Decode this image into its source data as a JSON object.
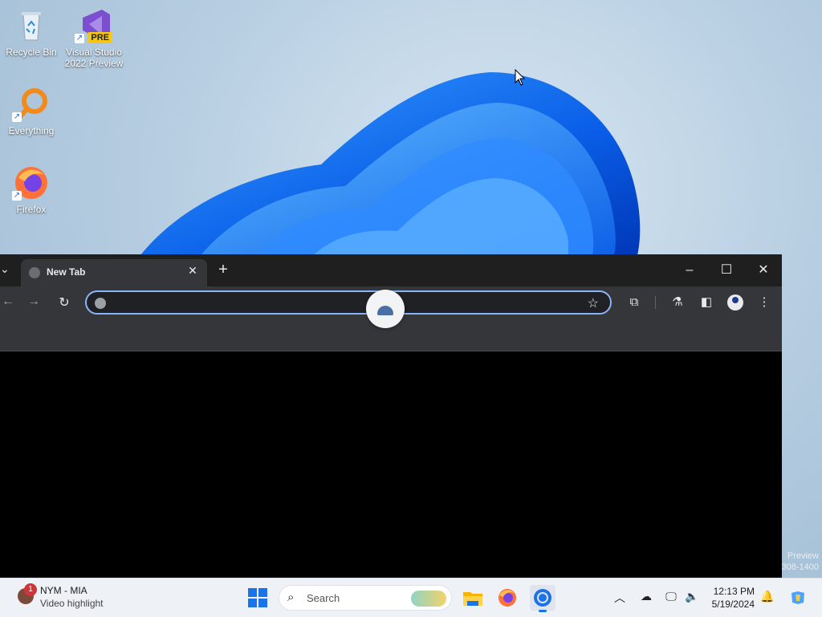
{
  "desktop": {
    "icons": [
      {
        "label": "Recycle Bin",
        "icon": "recycle-bin-icon"
      },
      {
        "label": "Visual Studio 2022 Preview",
        "label_line1": "Visual Studio",
        "label_line2": "2022 Preview",
        "badge": "PRE",
        "icon": "visual-studio-icon"
      },
      {
        "label": "Everything",
        "icon": "everything-search-icon"
      },
      {
        "label": "Firefox",
        "icon": "firefox-icon"
      }
    ],
    "watermark_line1": "Preview",
    "watermark_line2": "308-1400"
  },
  "browser": {
    "tab_title": "New Tab",
    "omnibox_value": "",
    "omnibox_placeholder": "",
    "colors": {
      "accent": "#8ab4f8",
      "toolbar": "#35363a",
      "tabstrip": "#1f1f1f"
    }
  },
  "taskbar": {
    "weather": {
      "badge": "1",
      "line1": "NYM - MIA",
      "line2": "Video highlight"
    },
    "search_label": "Search",
    "apps": [
      "start-button",
      "search",
      "file-explorer",
      "firefox",
      "chrome"
    ],
    "clock": {
      "time": "12:13 PM",
      "date": "5/19/2024"
    },
    "colors": {
      "accent": "#1a73e8"
    }
  }
}
